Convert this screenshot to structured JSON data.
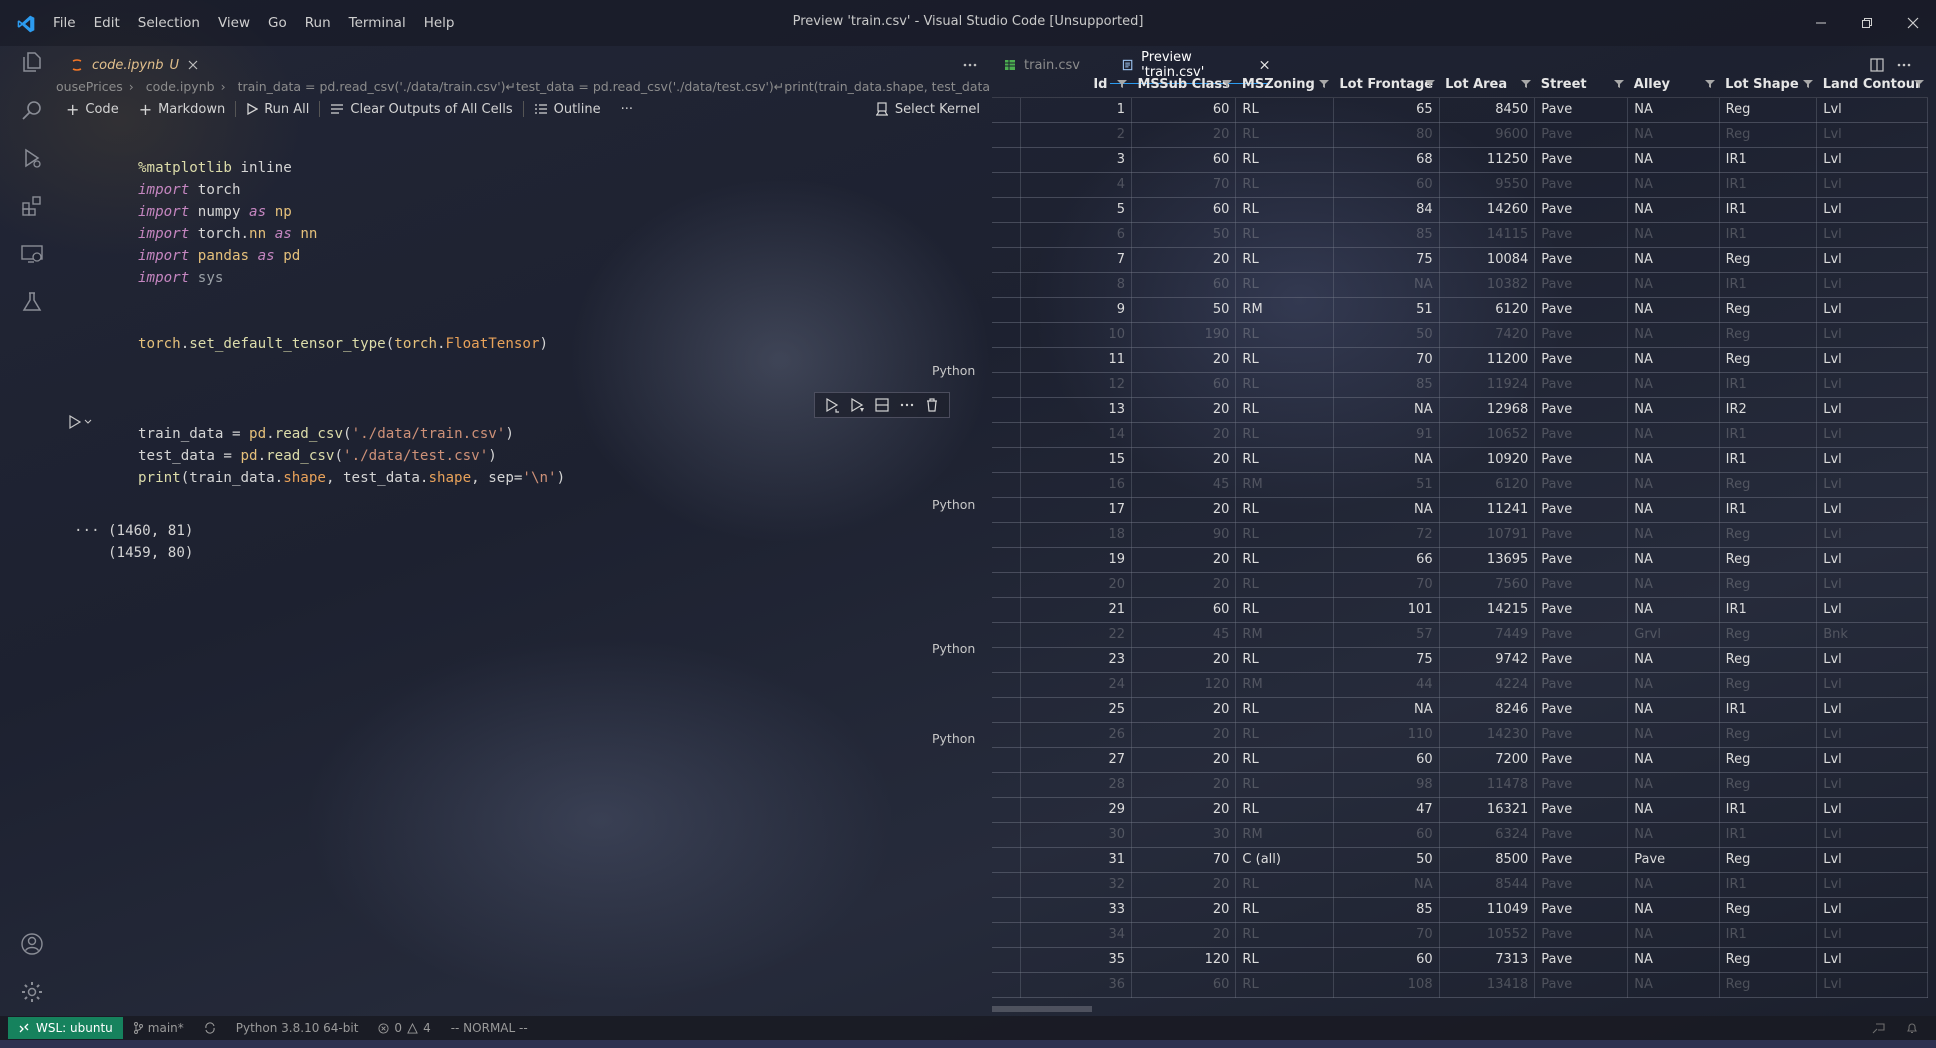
{
  "window": {
    "title": "Preview 'train.csv' - Visual Studio Code [Unsupported]",
    "menu": [
      "File",
      "Edit",
      "Selection",
      "View",
      "Go",
      "Run",
      "Terminal",
      "Help"
    ]
  },
  "colors": {
    "accent": "#007acc",
    "wsl_badge": "#16825d",
    "code_tab_label": "#e2c08d"
  },
  "left_editor": {
    "tab": {
      "label": "code.ipynb",
      "modified_flag": "U"
    },
    "breadcrumb": {
      "seg1": "ousePrices",
      "seg2": "code.ipynb",
      "seg3": "train_data = pd.read_csv('./data/train.csv')↵test_data = pd.read_csv('./data/test.csv')↵print(train_data.shape, test_data.shape ..."
    },
    "toolbar": {
      "code": "Code",
      "markdown": "Markdown",
      "run_all": "Run All",
      "clear_outputs": "Clear Outputs of All Cells",
      "outline": "Outline",
      "more": "···",
      "select_kernel": "Select Kernel"
    },
    "cell_language": "Python",
    "outputs": {
      "ellipsis": "···",
      "line1": "(1460, 81)",
      "line2": "(1459, 80)"
    }
  },
  "right_editor": {
    "tabs": [
      {
        "label": "train.csv"
      },
      {
        "label": "Preview 'train.csv'"
      }
    ],
    "grid": {
      "columns": [
        "Id",
        "MSSub Class",
        "MSZoning",
        "Lot Frontage",
        "Lot Area",
        "Street",
        "Alley",
        "Lot Shape",
        "Land Contour"
      ],
      "rows": [
        [
          "1",
          "60",
          "RL",
          "65",
          "8450",
          "Pave",
          "NA",
          "Reg",
          "Lvl"
        ],
        [
          "2",
          "20",
          "RL",
          "80",
          "9600",
          "Pave",
          "NA",
          "Reg",
          "Lvl"
        ],
        [
          "3",
          "60",
          "RL",
          "68",
          "11250",
          "Pave",
          "NA",
          "IR1",
          "Lvl"
        ],
        [
          "4",
          "70",
          "RL",
          "60",
          "9550",
          "Pave",
          "NA",
          "IR1",
          "Lvl"
        ],
        [
          "5",
          "60",
          "RL",
          "84",
          "14260",
          "Pave",
          "NA",
          "IR1",
          "Lvl"
        ],
        [
          "6",
          "50",
          "RL",
          "85",
          "14115",
          "Pave",
          "NA",
          "IR1",
          "Lvl"
        ],
        [
          "7",
          "20",
          "RL",
          "75",
          "10084",
          "Pave",
          "NA",
          "Reg",
          "Lvl"
        ],
        [
          "8",
          "60",
          "RL",
          "NA",
          "10382",
          "Pave",
          "NA",
          "IR1",
          "Lvl"
        ],
        [
          "9",
          "50",
          "RM",
          "51",
          "6120",
          "Pave",
          "NA",
          "Reg",
          "Lvl"
        ],
        [
          "10",
          "190",
          "RL",
          "50",
          "7420",
          "Pave",
          "NA",
          "Reg",
          "Lvl"
        ],
        [
          "11",
          "20",
          "RL",
          "70",
          "11200",
          "Pave",
          "NA",
          "Reg",
          "Lvl"
        ],
        [
          "12",
          "60",
          "RL",
          "85",
          "11924",
          "Pave",
          "NA",
          "IR1",
          "Lvl"
        ],
        [
          "13",
          "20",
          "RL",
          "NA",
          "12968",
          "Pave",
          "NA",
          "IR2",
          "Lvl"
        ],
        [
          "14",
          "20",
          "RL",
          "91",
          "10652",
          "Pave",
          "NA",
          "IR1",
          "Lvl"
        ],
        [
          "15",
          "20",
          "RL",
          "NA",
          "10920",
          "Pave",
          "NA",
          "IR1",
          "Lvl"
        ],
        [
          "16",
          "45",
          "RM",
          "51",
          "6120",
          "Pave",
          "NA",
          "Reg",
          "Lvl"
        ],
        [
          "17",
          "20",
          "RL",
          "NA",
          "11241",
          "Pave",
          "NA",
          "IR1",
          "Lvl"
        ],
        [
          "18",
          "90",
          "RL",
          "72",
          "10791",
          "Pave",
          "NA",
          "Reg",
          "Lvl"
        ],
        [
          "19",
          "20",
          "RL",
          "66",
          "13695",
          "Pave",
          "NA",
          "Reg",
          "Lvl"
        ],
        [
          "20",
          "20",
          "RL",
          "70",
          "7560",
          "Pave",
          "NA",
          "Reg",
          "Lvl"
        ],
        [
          "21",
          "60",
          "RL",
          "101",
          "14215",
          "Pave",
          "NA",
          "IR1",
          "Lvl"
        ],
        [
          "22",
          "45",
          "RM",
          "57",
          "7449",
          "Pave",
          "Grvl",
          "Reg",
          "Bnk"
        ],
        [
          "23",
          "20",
          "RL",
          "75",
          "9742",
          "Pave",
          "NA",
          "Reg",
          "Lvl"
        ],
        [
          "24",
          "120",
          "RM",
          "44",
          "4224",
          "Pave",
          "NA",
          "Reg",
          "Lvl"
        ],
        [
          "25",
          "20",
          "RL",
          "NA",
          "8246",
          "Pave",
          "NA",
          "IR1",
          "Lvl"
        ],
        [
          "26",
          "20",
          "RL",
          "110",
          "14230",
          "Pave",
          "NA",
          "Reg",
          "Lvl"
        ],
        [
          "27",
          "20",
          "RL",
          "60",
          "7200",
          "Pave",
          "NA",
          "Reg",
          "Lvl"
        ],
        [
          "28",
          "20",
          "RL",
          "98",
          "11478",
          "Pave",
          "NA",
          "Reg",
          "Lvl"
        ],
        [
          "29",
          "20",
          "RL",
          "47",
          "16321",
          "Pave",
          "NA",
          "IR1",
          "Lvl"
        ],
        [
          "30",
          "30",
          "RM",
          "60",
          "6324",
          "Pave",
          "NA",
          "IR1",
          "Lvl"
        ],
        [
          "31",
          "70",
          "C (all)",
          "50",
          "8500",
          "Pave",
          "Pave",
          "Reg",
          "Lvl"
        ],
        [
          "32",
          "20",
          "RL",
          "NA",
          "8544",
          "Pave",
          "NA",
          "IR1",
          "Lvl"
        ],
        [
          "33",
          "20",
          "RL",
          "85",
          "11049",
          "Pave",
          "NA",
          "Reg",
          "Lvl"
        ],
        [
          "34",
          "20",
          "RL",
          "70",
          "10552",
          "Pave",
          "NA",
          "IR1",
          "Lvl"
        ],
        [
          "35",
          "120",
          "RL",
          "60",
          "7313",
          "Pave",
          "NA",
          "Reg",
          "Lvl"
        ],
        [
          "36",
          "60",
          "RL",
          "108",
          "13418",
          "Pave",
          "NA",
          "Reg",
          "Lvl"
        ]
      ]
    }
  },
  "statusbar": {
    "remote": "WSL: ubuntu",
    "branch": "main*",
    "python": "Python 3.8.10 64-bit",
    "errors": "0",
    "warnings": "4",
    "mode": "-- NORMAL --"
  }
}
